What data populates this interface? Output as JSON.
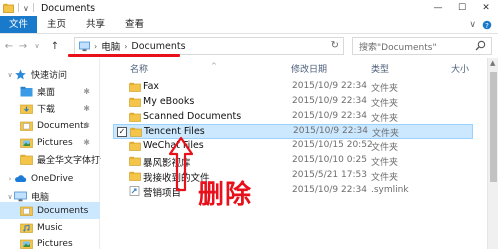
{
  "window": {
    "title": "Documents",
    "controls": [
      "—",
      "☐",
      "✕"
    ]
  },
  "ribbon": {
    "tabs": [
      "文件",
      "主页",
      "共享",
      "查看"
    ],
    "help_chevron": "∨"
  },
  "address": {
    "segments": [
      "电脑",
      "Documents"
    ],
    "search_placeholder": "搜索\"Documents\""
  },
  "navpane": {
    "items": [
      {
        "label": "快速访问",
        "icon": "star-icon",
        "pinned": false
      },
      {
        "label": "桌面",
        "icon": "desktop-folder-icon",
        "pinned": true
      },
      {
        "label": "下载",
        "icon": "download-folder-icon",
        "pinned": true
      },
      {
        "label": "Documents",
        "icon": "documents-folder-icon",
        "pinned": true
      },
      {
        "label": "Pictures",
        "icon": "pictures-folder-icon",
        "pinned": true
      },
      {
        "label": "最全华文字体打包",
        "icon": "folder-icon",
        "pinned": false
      },
      {
        "label": "OneDrive",
        "icon": "cloud-icon",
        "pinned": false
      },
      {
        "label": "电脑",
        "icon": "computer-icon",
        "pinned": false
      },
      {
        "label": "Documents",
        "icon": "documents-folder-icon",
        "pinned": false
      },
      {
        "label": "Music",
        "icon": "music-folder-icon",
        "pinned": false
      },
      {
        "label": "Pictures",
        "icon": "pictures-folder-icon",
        "pinned": false
      }
    ]
  },
  "columns": {
    "name": "名称",
    "date": "修改日期",
    "type": "类型",
    "size": "大小"
  },
  "files": [
    {
      "name": "Fax",
      "date": "2015/10/9 22:34",
      "type": "文件夹",
      "icon": "folder-icon"
    },
    {
      "name": "My eBooks",
      "date": "2015/10/9 22:34",
      "type": "文件夹",
      "icon": "folder-icon"
    },
    {
      "name": "Scanned Documents",
      "date": "2015/10/9 22:34",
      "type": "文件夹",
      "icon": "folder-icon"
    },
    {
      "name": "Tencent Files",
      "date": "2015/10/9 22:34",
      "type": "文件夹",
      "icon": "folder-icon",
      "selected": true
    },
    {
      "name": "WeChat Files",
      "date": "2015/10/15 20:52",
      "type": "文件夹",
      "icon": "folder-icon"
    },
    {
      "name": "暴风影视库",
      "date": "2015/10/10 0:25",
      "type": "文件夹",
      "icon": "folder-icon"
    },
    {
      "name": "我接收到的文件",
      "date": "2015/5/21 17:53",
      "type": "文件夹",
      "icon": "folder-icon"
    },
    {
      "name": "营销项目",
      "date": "2015/10/9 22:34",
      "type": ".symlink",
      "icon": "symlink-icon"
    }
  ],
  "annotation": {
    "text": "删除",
    "color": "#e8101a"
  },
  "colors": {
    "accent": "#1979ca",
    "selection": "#cce8ff",
    "folder": "#f5c54a",
    "annotation": "#e8101a"
  }
}
